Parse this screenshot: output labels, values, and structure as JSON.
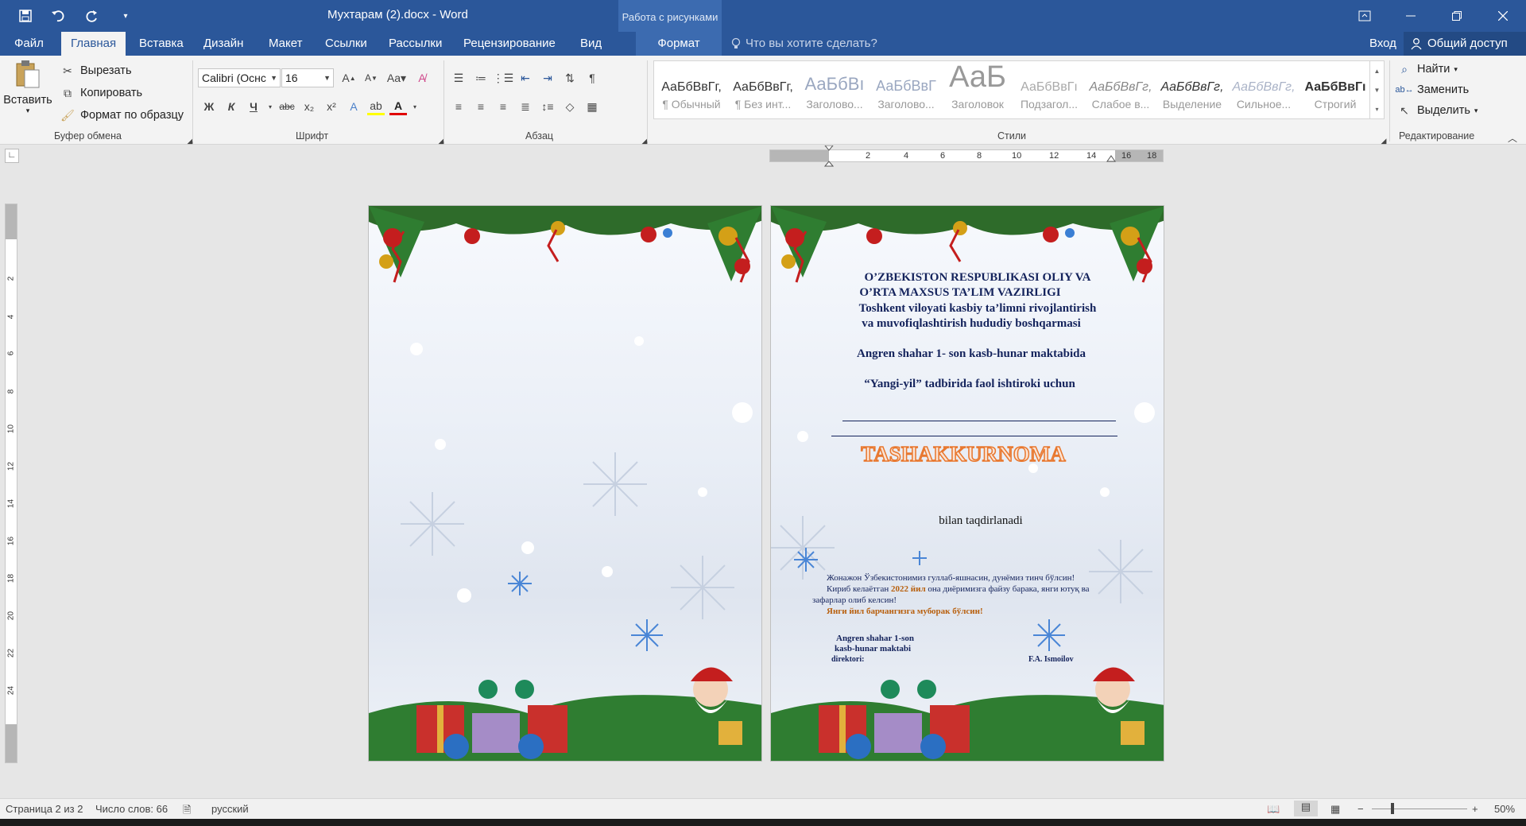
{
  "window": {
    "document_title": "Мухтарам (2).docx - Word",
    "context_tab_title": "Работа с рисунками"
  },
  "tabs": [
    "Файл",
    "Главная",
    "Вставка",
    "Дизайн",
    "Макет",
    "Ссылки",
    "Рассылки",
    "Рецензирование",
    "Вид",
    "Формат"
  ],
  "tell_me": "Что вы хотите сделать?",
  "sign_in": "Вход",
  "share": "Общий доступ",
  "clipboard": {
    "paste": "Вставить",
    "cut": "Вырезать",
    "copy": "Копировать",
    "format_painter": "Формат по образцу",
    "label": "Буфер обмена"
  },
  "font": {
    "name": "Calibri (Оснс",
    "size": "16",
    "label": "Шрифт",
    "bold": "Ж",
    "italic": "К",
    "underline": "Ч"
  },
  "paragraph": {
    "label": "Абзац"
  },
  "styles": {
    "label": "Стили",
    "items": [
      {
        "sample": "АаБбВвГг,",
        "name": "¶ Обычный"
      },
      {
        "sample": "АаБбВвГг,",
        "name": "¶ Без инт..."
      },
      {
        "sample": "АаБбВı",
        "name": "Заголово..."
      },
      {
        "sample": "АаБбВвГ",
        "name": "Заголово..."
      },
      {
        "sample": "АаБ",
        "name": "Заголовок"
      },
      {
        "sample": "АаБбВвГı",
        "name": "Подзагол..."
      },
      {
        "sample": "АаБбВвГг,",
        "name": "Слабое в..."
      },
      {
        "sample": "АаБбВвГг,",
        "name": "Выделение"
      },
      {
        "sample": "АаБбВвГг,",
        "name": "Сильное..."
      },
      {
        "sample": "АаБбВвГı",
        "name": "Строгий"
      }
    ]
  },
  "editing": {
    "label": "Редактирование",
    "find": "Найти",
    "replace": "Заменить",
    "select": "Выделить"
  },
  "hruler_numbers": [
    "2",
    "4",
    "6",
    "8",
    "10",
    "12",
    "14",
    "16",
    "18"
  ],
  "vruler_numbers": [
    "2",
    "4",
    "6",
    "8",
    "10",
    "12",
    "14",
    "16",
    "18",
    "20",
    "22",
    "24"
  ],
  "certificate": {
    "line1": "O’ZBEKISTON RESPUBLIKASI  OLIY VA",
    "line2": "O’RTA MAXSUS TA’LIM VAZIRLIGI",
    "line3": "Toshkent viloyati kasbiy ta’limni rivojlantirish",
    "line4": "va muvofiqlashtirish hududiy boshqarmasi",
    "line5": "Angren shahar 1- son  kasb-hunar maktabida",
    "line6": "“Yangi-yil” tadbirida faol ishtiroki uchun",
    "title": "TASHAKKURNOMA",
    "awarded": "bilan taqdirlanadi",
    "wish1": "Жонажон Ўзбекистонимиз гуллаб-яшнасин, дунёмиз тинч бўлсин!",
    "wish2_a": "Кириб келаётган ",
    "wish2_year": "2022 йил",
    "wish2_b": " она диёримизга файзу барака, янги ютуқ ва",
    "wish3": "зафарлар олиб келсин!",
    "wish4": "Янги йил барчангизга муборак бўлсин!",
    "sign1": "Angren shahar  1-son",
    "sign2": "kasb-hunar  maktabi",
    "sign3": "direktori:",
    "signer": "F.A. Ismoilov"
  },
  "status": {
    "page": "Страница 2 из 2",
    "words": "Число слов: 66",
    "language": "русский",
    "zoom": "50%"
  },
  "colors": {
    "word_blue": "#2b579a",
    "title_orange": "#e8772e",
    "text_navy": "#14235c"
  }
}
